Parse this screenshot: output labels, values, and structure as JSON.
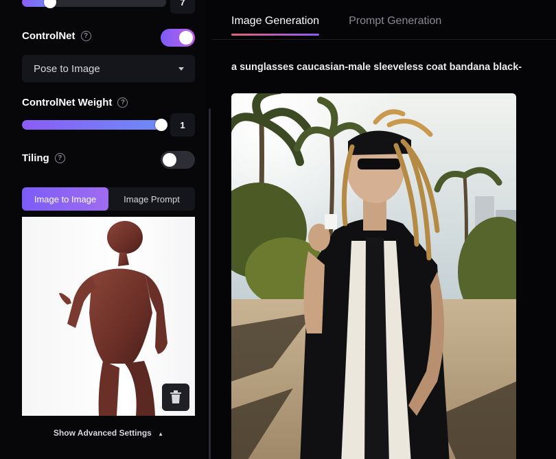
{
  "sidebar": {
    "top_slider": {
      "value": "7",
      "level": 0.29
    },
    "controlnet": {
      "label": "ControlNet",
      "help": "?",
      "enabled": true
    },
    "mode_select": {
      "value": "Pose to Image"
    },
    "weight": {
      "label": "ControlNet Weight",
      "help": "?",
      "value": "1",
      "level": 1.0
    },
    "tiling": {
      "label": "Tiling",
      "help": "?",
      "enabled": false
    },
    "source_tabs": [
      {
        "label": "Image to Image",
        "active": true
      },
      {
        "label": "Image Prompt",
        "active": false
      }
    ],
    "advanced_label": "Show Advanced Settings",
    "advanced_chevron": "▲"
  },
  "main": {
    "tabs": [
      {
        "label": "Image Generation",
        "active": true
      },
      {
        "label": "Prompt Generation",
        "active": false
      }
    ],
    "prompt": "a sunglasses caucasian-male sleeveless coat bandana black-"
  },
  "colors": {
    "accent_purple": "#8b5cf6",
    "accent_pink": "#e8607a",
    "panel_bg": "#07070a",
    "control_bg": "#15151c"
  },
  "icons": {
    "help": "help-circle-icon",
    "dropdown": "chevron-down-icon",
    "delete": "trash-icon",
    "advanced": "chevron-up-icon"
  }
}
